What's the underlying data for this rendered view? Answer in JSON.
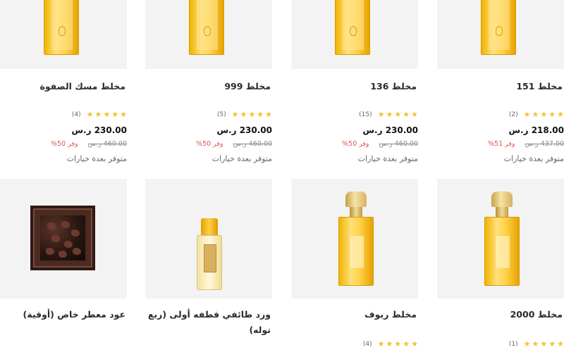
{
  "products": [
    {
      "name": "مخلط 151",
      "rating_count": "(2)",
      "stars": 5,
      "price": "218.00 ر.س",
      "old_price": "437.00 ر.س",
      "save": "وفر 51%",
      "availability": "متوفر بعدة خيارات",
      "image": "yellow-perfume-bottle"
    },
    {
      "name": "مخلط 136",
      "rating_count": "(15)",
      "stars": 5,
      "price": "230.00 ر.س",
      "old_price": "460.00 ر.س",
      "save": "وفر 50%",
      "availability": "متوفر بعدة خيارات",
      "image": "yellow-perfume-bottle"
    },
    {
      "name": "مخلط 999",
      "rating_count": "(5)",
      "stars": 5,
      "price": "230.00 ر.س",
      "old_price": "460.00 ر.س",
      "save": "وفر 50%",
      "availability": "متوفر بعدة خيارات",
      "image": "yellow-perfume-bottle"
    },
    {
      "name": "مخلط مسك الصفوة",
      "rating_count": "(4)",
      "stars": 5,
      "price": "230.00 ر.س",
      "old_price": "460.00 ر.س",
      "save": "وفر 50%",
      "availability": "متوفر بعدة خيارات",
      "image": "yellow-perfume-bottle"
    },
    {
      "name": "مخلط 2000",
      "rating_count": "(1)",
      "stars": 5,
      "image": "yellow-perfume-bottle-with-cap"
    },
    {
      "name": "مخلط ريوف",
      "rating_count": "(4)",
      "stars": 5,
      "image": "yellow-perfume-bottle-with-cap"
    },
    {
      "name": "ورد طائفي قطفه أولى (ربع توله)",
      "image": "oil-vial"
    },
    {
      "name": "عود معطر خاص (أوقية)",
      "image": "oud-box"
    }
  ],
  "colors": {
    "star": "#f1c232",
    "save": "#e05656",
    "image_bg": "#f3f3f3"
  }
}
